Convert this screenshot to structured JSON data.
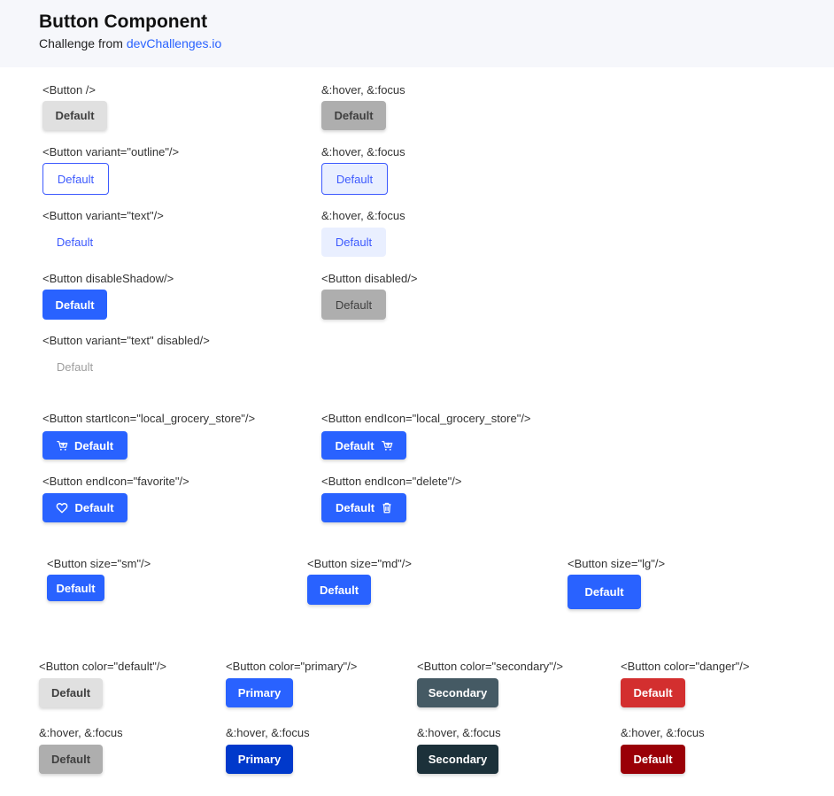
{
  "header": {
    "title": "Button Component",
    "subtitle_prefix": "Challenge from",
    "link_text": "devChallenges.io"
  },
  "colors": {
    "primary": "#2962FF",
    "primary_hover": "#0039CB",
    "secondary": "#455A64",
    "secondary_hover": "#1C313A",
    "danger": "#D32F2F",
    "danger_hover": "#9A0007",
    "default": "#E0E0E0",
    "default_hover": "#AEAEAE",
    "header_bg": "#F6F7FB"
  },
  "variants": {
    "default_label": "<Button />",
    "default_button": "Default",
    "default_hover_label": "&:hover, &:focus",
    "default_hover_button": "Default",
    "outline_label": "<Button variant=\"outline\"/>",
    "outline_button": "Default",
    "outline_hover_label": "&:hover, &:focus",
    "outline_hover_button": "Default",
    "text_label": "<Button variant=\"text\"/>",
    "text_button": "Default",
    "text_hover_label": "&:hover, &:focus",
    "text_hover_button": "Default",
    "disable_shadow_label": "<Button disableShadow/>",
    "disable_shadow_button": "Default",
    "disabled_label": "<Button disabled/>",
    "disabled_button": "Default",
    "text_disabled_label": "<Button variant=\"text\" disabled/>",
    "text_disabled_button": "Default"
  },
  "icons": {
    "start_icon_label": "<Button startIcon=\"local_grocery_store\"/>",
    "start_icon_button": "Default",
    "start_icon_name": "cart-icon",
    "end_icon_label": "<Button endIcon=\"local_grocery_store\"/>",
    "end_icon_button": "Default",
    "end_icon_name": "cart-icon",
    "favorite_label": "<Button endIcon=\"favorite\"/>",
    "favorite_button": "Default",
    "favorite_icon_name": "heart-icon",
    "delete_label": "<Button endIcon=\"delete\"/>",
    "delete_button": "Default",
    "delete_icon_name": "trash-icon"
  },
  "sizes": {
    "sm_label": "<Button size=\"sm\"/>",
    "sm_button": "Default",
    "md_label": "<Button size=\"md\"/>",
    "md_button": "Default",
    "lg_label": "<Button size=\"lg\"/>",
    "lg_button": "Default"
  },
  "color_variants": {
    "default_label": "<Button color=\"default\"/>",
    "default_button": "Default",
    "primary_label": "<Button color=\"primary\"/>",
    "primary_button": "Primary",
    "secondary_label": "<Button color=\"secondary\"/>",
    "secondary_button": "Secondary",
    "danger_label": "<Button color=\"danger\"/>",
    "danger_button": "Default",
    "default_hover_label": "&:hover, &:focus",
    "default_hover_button": "Default",
    "primary_hover_label": "&:hover, &:focus",
    "primary_hover_button": "Primary",
    "secondary_hover_label": "&:hover, &:focus",
    "secondary_hover_button": "Secondary",
    "danger_hover_label": "&:hover, &:focus",
    "danger_hover_button": "Default"
  }
}
